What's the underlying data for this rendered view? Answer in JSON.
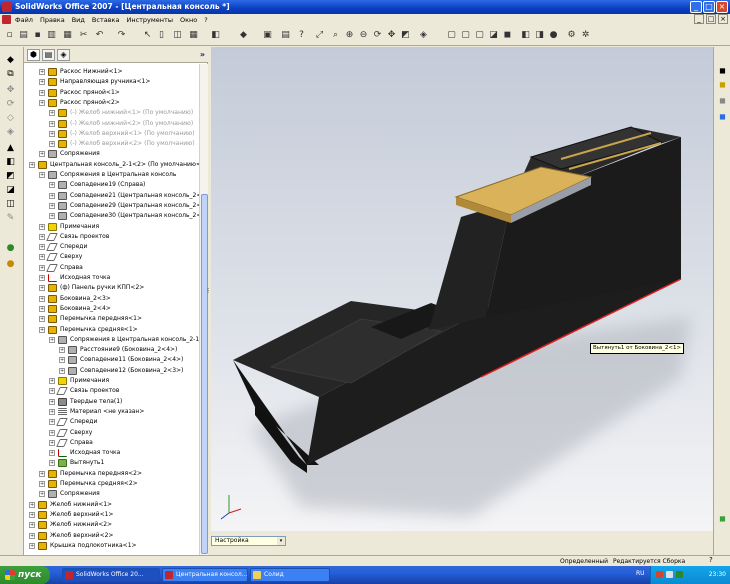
{
  "window": {
    "title": "SolidWorks Office 2007 - [Центральная консоль *]",
    "min": "_",
    "max": "□",
    "close": "×"
  },
  "menu": [
    "Файл",
    "Правка",
    "Вид",
    "Вставка",
    "Инструменты",
    "Окно",
    "?"
  ],
  "doc_buttons": [
    "_",
    "□",
    "×"
  ],
  "tree": [
    {
      "label": "Раскос Нижний<1>",
      "indent": 1,
      "icon": "feat"
    },
    {
      "label": "Направляющая ручника<1>",
      "indent": 1,
      "icon": "feat"
    },
    {
      "label": "Раскос пряной<1>",
      "indent": 1,
      "icon": "feat"
    },
    {
      "label": "Раскос пряной<2>",
      "indent": 1,
      "icon": "feat"
    },
    {
      "label": "(-) Желоб нижний<1> (По умолчанию)",
      "indent": 2,
      "icon": "feat",
      "grey": true
    },
    {
      "label": "(-) Желоб нижний<2> (По умолчанию)",
      "indent": 2,
      "icon": "feat",
      "grey": true
    },
    {
      "label": "(-) Желоб верхний<1> (По умолчанию)",
      "indent": 2,
      "icon": "feat",
      "grey": true
    },
    {
      "label": "(-) Желоб верхний<2> (По умолчанию)",
      "indent": 2,
      "icon": "feat",
      "grey": true
    },
    {
      "label": "Сопряжения",
      "indent": 1,
      "icon": "mate"
    },
    {
      "label": "Центральная консоль_2-1<2> (По умолчанию<Со",
      "indent": 0,
      "icon": "feat"
    },
    {
      "label": "Сопряжения в Центральная консоль",
      "indent": 1,
      "icon": "mate"
    },
    {
      "label": "Совпадение19 (Справа)",
      "indent": 2,
      "icon": "mate"
    },
    {
      "label": "Совпадение21 (Центральная консоль_2<1",
      "indent": 2,
      "icon": "mate"
    },
    {
      "label": "Совпадение29 (Центральная консоль_2<1",
      "indent": 2,
      "icon": "mate"
    },
    {
      "label": "Совпадение30 (Центральная консоль_2<1",
      "indent": 2,
      "icon": "mate"
    },
    {
      "label": "Примечания",
      "indent": 1,
      "icon": "note"
    },
    {
      "label": "Связь проектов",
      "indent": 1,
      "icon": "plane"
    },
    {
      "label": "Спереди",
      "indent": 1,
      "icon": "plane"
    },
    {
      "label": "Сверху",
      "indent": 1,
      "icon": "plane"
    },
    {
      "label": "Справа",
      "indent": 1,
      "icon": "plane"
    },
    {
      "label": "Исходная точка",
      "indent": 1,
      "icon": "origin"
    },
    {
      "label": "(ф) Панель ручки КПП<2>",
      "indent": 1,
      "icon": "feat"
    },
    {
      "label": "Боковина_2<3>",
      "indent": 1,
      "icon": "feat"
    },
    {
      "label": "Боковина_2<4>",
      "indent": 1,
      "icon": "feat"
    },
    {
      "label": "Перемычка передняя<1>",
      "indent": 1,
      "icon": "feat"
    },
    {
      "label": "Перемычка средняя<1>",
      "indent": 1,
      "icon": "feat"
    },
    {
      "label": "Сопряжения в Центральная консоль_2-1",
      "indent": 2,
      "icon": "mate"
    },
    {
      "label": "Расстояние9 (Боковина_2<4>)",
      "indent": 3,
      "icon": "mate"
    },
    {
      "label": "Совпадение11 (Боковина_2<4>)",
      "indent": 3,
      "icon": "mate"
    },
    {
      "label": "Совпадение12 (Боковина_2<3>)",
      "indent": 3,
      "icon": "mate"
    },
    {
      "label": "Примечания",
      "indent": 2,
      "icon": "note"
    },
    {
      "label": "Связь проектов",
      "indent": 2,
      "icon": "plane"
    },
    {
      "label": "Твердые тела(1)",
      "indent": 2,
      "icon": "solid"
    },
    {
      "label": "Материал <не указан>",
      "indent": 2,
      "icon": "mat"
    },
    {
      "label": "Спереди",
      "indent": 2,
      "icon": "plane"
    },
    {
      "label": "Сверху",
      "indent": 2,
      "icon": "plane"
    },
    {
      "label": "Справа",
      "indent": 2,
      "icon": "plane"
    },
    {
      "label": "Исходная точка",
      "indent": 2,
      "icon": "origin"
    },
    {
      "label": "Вытянуть1",
      "indent": 2,
      "icon": "extrude"
    },
    {
      "label": "Перемычка передняя<2>",
      "indent": 1,
      "icon": "feat"
    },
    {
      "label": "Перемычка средняя<2>",
      "indent": 1,
      "icon": "feat"
    },
    {
      "label": "Сопряжения",
      "indent": 1,
      "icon": "mate"
    },
    {
      "label": "Желоб нижний<1>",
      "indent": 0,
      "icon": "feat"
    },
    {
      "label": "Желоб верхний<1>",
      "indent": 0,
      "icon": "feat"
    },
    {
      "label": "Желоб нижний<2>",
      "indent": 0,
      "icon": "feat"
    },
    {
      "label": "Желоб верхний<2>",
      "indent": 0,
      "icon": "feat"
    },
    {
      "label": "Крышка подлокотника<1>",
      "indent": 0,
      "icon": "feat"
    }
  ],
  "viewport": {
    "tooltip": "Вытянуть1 от Боковина_2<1>",
    "model_color": "#1c1c1c",
    "lid_color": "#d9b25a",
    "edge_highlight": "#e02020"
  },
  "config": {
    "value": "Настройка",
    "arrow": "▾"
  },
  "status": {
    "state": "Определенный",
    "mode": "Редактируется Сборка",
    "help": "?"
  },
  "taskbar": {
    "start": "пуск",
    "tasks": [
      "SolidWorks Office 20...",
      "Центральная консол...",
      "Солид"
    ],
    "lang": "RU",
    "clock": "23:30"
  },
  "colors": {
    "titlebar": "#0a3fc3",
    "selection": "#c1d3fb"
  }
}
